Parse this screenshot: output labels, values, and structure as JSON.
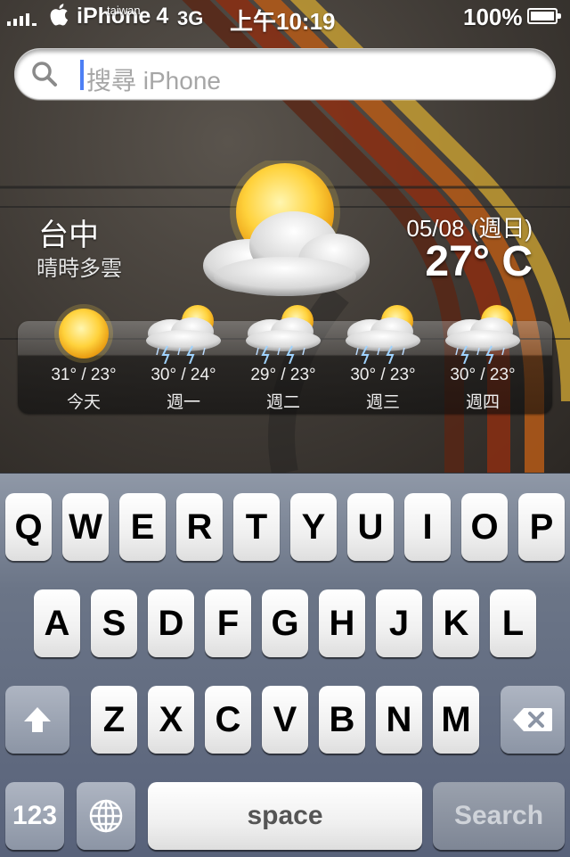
{
  "status_bar": {
    "carrier": "iPhone",
    "carrier_suffix": "4",
    "carrier_superscript": "taiwan",
    "network": "3G",
    "time": "上午10:19",
    "battery": "100%",
    "icons": [
      "signal-icon",
      "apple-icon",
      "battery-icon"
    ]
  },
  "search": {
    "placeholder": "搜尋 iPhone",
    "icon": "search-icon"
  },
  "weather": {
    "city": "台中",
    "condition": "晴時多雲",
    "date": "05/08 (週日)",
    "temperature": "27° C",
    "current_icon": "partly-cloudy-icon",
    "forecast": [
      {
        "day": "今天",
        "temps": "31° / 23°",
        "icon": "sunny-icon"
      },
      {
        "day": "週一",
        "temps": "30° / 24°",
        "icon": "thunderstorm-icon"
      },
      {
        "day": "週二",
        "temps": "29° / 23°",
        "icon": "thunderstorm-icon"
      },
      {
        "day": "週三",
        "temps": "30° / 23°",
        "icon": "thunderstorm-icon"
      },
      {
        "day": "週四",
        "temps": "30° / 23°",
        "icon": "thunderstorm-icon"
      }
    ]
  },
  "keyboard": {
    "row1": [
      "Q",
      "W",
      "E",
      "R",
      "T",
      "Y",
      "U",
      "I",
      "O",
      "P"
    ],
    "row2": [
      "A",
      "S",
      "D",
      "F",
      "G",
      "H",
      "J",
      "K",
      "L"
    ],
    "row3": [
      "Z",
      "X",
      "C",
      "V",
      "B",
      "N",
      "M"
    ],
    "numbers_label": "123",
    "space_label": "space",
    "search_label": "Search",
    "special_icons": [
      "shift-icon",
      "backspace-icon",
      "globe-icon"
    ]
  },
  "colors": {
    "caret": "#4d7ff5",
    "keyboard_bg": "#6b7587"
  }
}
